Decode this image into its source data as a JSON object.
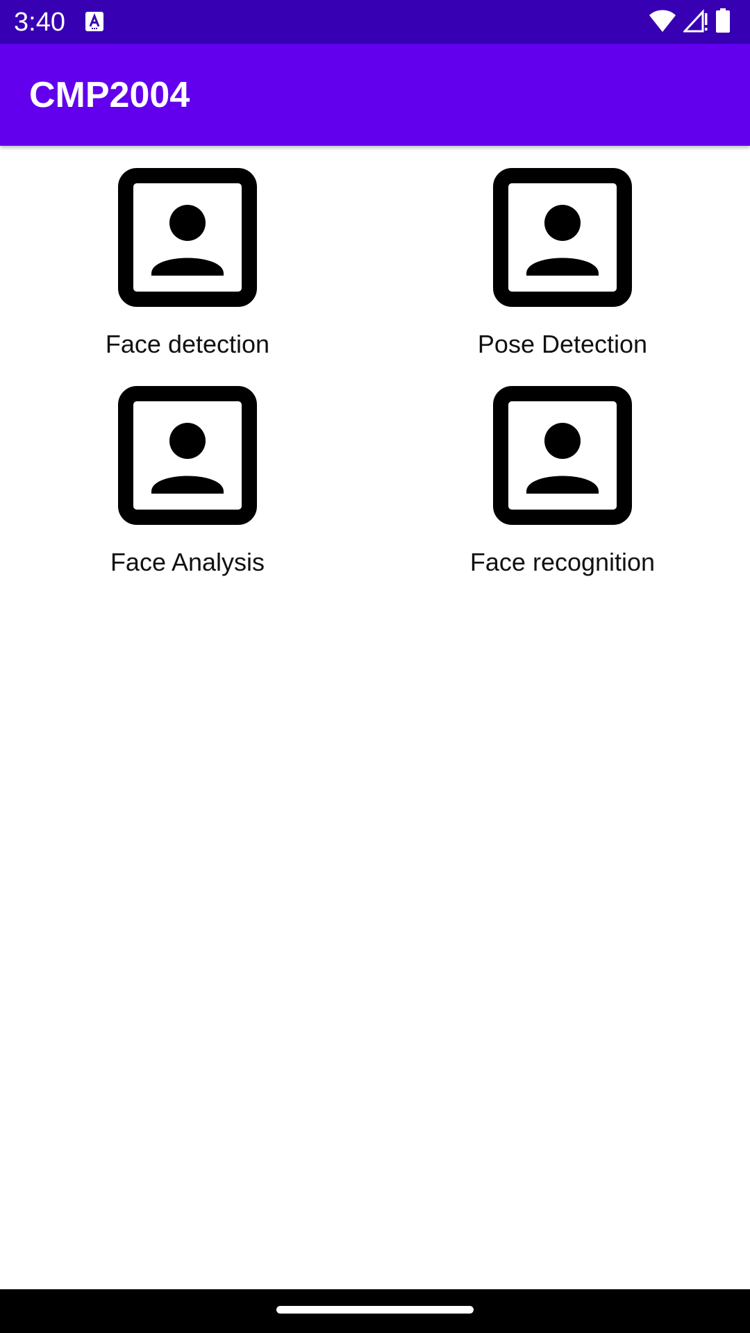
{
  "status_bar": {
    "time": "3:40",
    "notification_icon": "a-text-icon",
    "wifi_icon": "wifi-icon",
    "signal_icon": "signal-no-data-icon",
    "battery_icon": "battery-icon",
    "background_color": "#3700b3"
  },
  "app_bar": {
    "title": "CMP2004",
    "background_color": "#6200ee"
  },
  "features": [
    {
      "label": "Face detection",
      "icon": "portrait-icon"
    },
    {
      "label": "Pose Detection",
      "icon": "portrait-icon"
    },
    {
      "label": "Face Analysis",
      "icon": "portrait-icon"
    },
    {
      "label": "Face recognition",
      "icon": "portrait-icon"
    }
  ]
}
